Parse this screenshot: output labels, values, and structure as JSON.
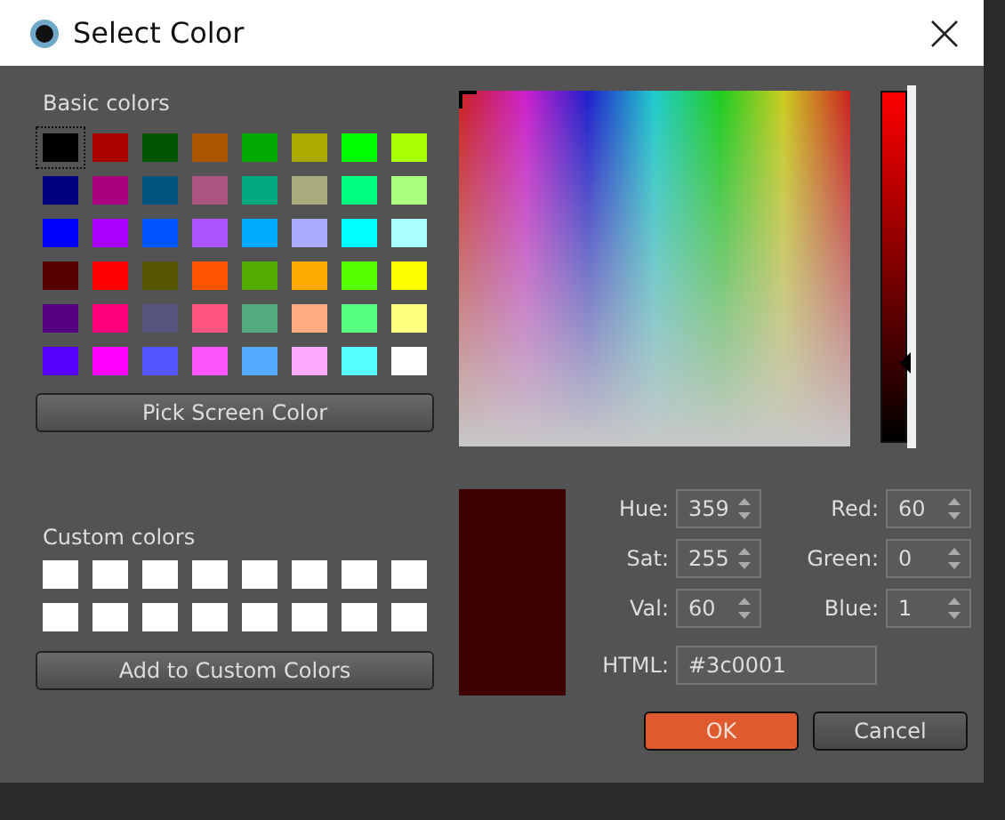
{
  "window": {
    "title": "Select Color"
  },
  "basic_colors": {
    "label": "Basic colors",
    "swatches": [
      {
        "color": "#000000",
        "selected": true
      },
      {
        "color": "#aa0000",
        "selected": false
      },
      {
        "color": "#005500",
        "selected": false
      },
      {
        "color": "#aa5500",
        "selected": false
      },
      {
        "color": "#00aa00",
        "selected": false
      },
      {
        "color": "#aaaa00",
        "selected": false
      },
      {
        "color": "#00ff00",
        "selected": false
      },
      {
        "color": "#aaff00",
        "selected": false
      },
      {
        "color": "#00007f",
        "selected": false
      },
      {
        "color": "#aa007f",
        "selected": false
      },
      {
        "color": "#00557f",
        "selected": false
      },
      {
        "color": "#aa557f",
        "selected": false
      },
      {
        "color": "#00aa7f",
        "selected": false
      },
      {
        "color": "#aaaa7f",
        "selected": false
      },
      {
        "color": "#00ff7f",
        "selected": false
      },
      {
        "color": "#aaff7f",
        "selected": false
      },
      {
        "color": "#0000ff",
        "selected": false
      },
      {
        "color": "#aa00ff",
        "selected": false
      },
      {
        "color": "#0055ff",
        "selected": false
      },
      {
        "color": "#aa55ff",
        "selected": false
      },
      {
        "color": "#00aaff",
        "selected": false
      },
      {
        "color": "#aaaaff",
        "selected": false
      },
      {
        "color": "#00ffff",
        "selected": false
      },
      {
        "color": "#aaffff",
        "selected": false
      },
      {
        "color": "#550000",
        "selected": false
      },
      {
        "color": "#ff0000",
        "selected": false
      },
      {
        "color": "#555500",
        "selected": false
      },
      {
        "color": "#ff5500",
        "selected": false
      },
      {
        "color": "#55aa00",
        "selected": false
      },
      {
        "color": "#ffaa00",
        "selected": false
      },
      {
        "color": "#55ff00",
        "selected": false
      },
      {
        "color": "#ffff00",
        "selected": false
      },
      {
        "color": "#55007f",
        "selected": false
      },
      {
        "color": "#ff007f",
        "selected": false
      },
      {
        "color": "#55557f",
        "selected": false
      },
      {
        "color": "#ff557f",
        "selected": false
      },
      {
        "color": "#55aa7f",
        "selected": false
      },
      {
        "color": "#ffaa7f",
        "selected": false
      },
      {
        "color": "#55ff7f",
        "selected": false
      },
      {
        "color": "#ffff7f",
        "selected": false
      },
      {
        "color": "#5500ff",
        "selected": false
      },
      {
        "color": "#ff00ff",
        "selected": false
      },
      {
        "color": "#5555ff",
        "selected": false
      },
      {
        "color": "#ff55ff",
        "selected": false
      },
      {
        "color": "#55aaff",
        "selected": false
      },
      {
        "color": "#ffaaff",
        "selected": false
      },
      {
        "color": "#55ffff",
        "selected": false
      },
      {
        "color": "#ffffff",
        "selected": false
      }
    ]
  },
  "pick_button": "Pick Screen Color",
  "custom_colors": {
    "label": "Custom colors",
    "swatches": [
      {
        "color": "#ffffff"
      },
      {
        "color": "#ffffff"
      },
      {
        "color": "#ffffff"
      },
      {
        "color": "#ffffff"
      },
      {
        "color": "#ffffff"
      },
      {
        "color": "#ffffff"
      },
      {
        "color": "#ffffff"
      },
      {
        "color": "#ffffff"
      },
      {
        "color": "#ffffff"
      },
      {
        "color": "#ffffff"
      },
      {
        "color": "#ffffff"
      },
      {
        "color": "#ffffff"
      },
      {
        "color": "#ffffff"
      },
      {
        "color": "#ffffff"
      },
      {
        "color": "#ffffff"
      },
      {
        "color": "#ffffff"
      }
    ]
  },
  "add_button": "Add to Custom Colors",
  "value_slider": {
    "level": 0.235
  },
  "preview": {
    "color": "#3c0001"
  },
  "spinboxes": [
    {
      "label": "Hue:",
      "value": "359"
    },
    {
      "label": "Red:",
      "value": "60"
    },
    {
      "label": "Sat:",
      "value": "255"
    },
    {
      "label": "Green:",
      "value": "0"
    },
    {
      "label": "Val:",
      "value": "60"
    },
    {
      "label": "Blue:",
      "value": "1"
    }
  ],
  "html": {
    "label": "HTML:",
    "value": "#3c0001"
  },
  "buttons": [
    {
      "label": "OK",
      "primary": true
    },
    {
      "label": "Cancel",
      "primary": false
    }
  ]
}
